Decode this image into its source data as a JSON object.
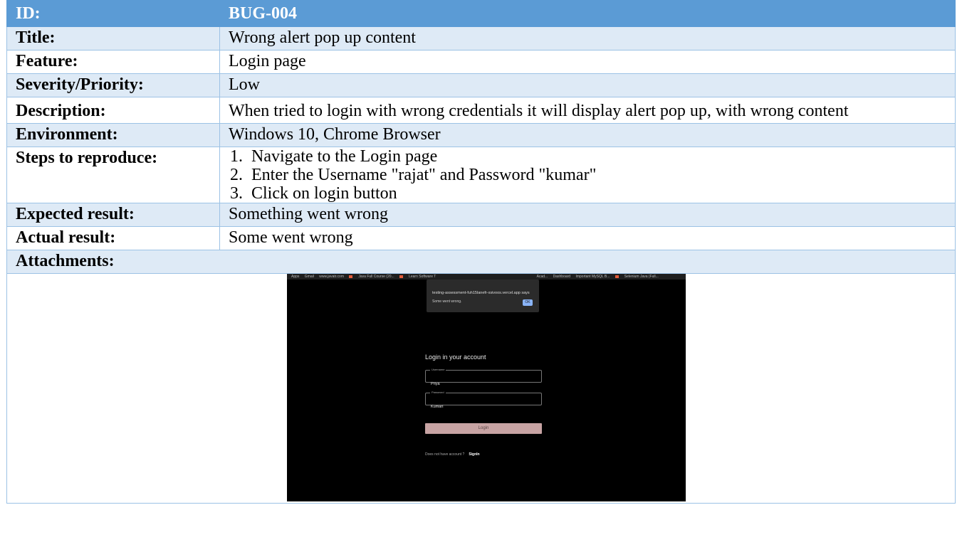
{
  "header": {
    "label": "ID:",
    "value": "BUG-004"
  },
  "rows": {
    "title": {
      "label": "Title:",
      "value": "Wrong alert pop up content"
    },
    "feature": {
      "label": "Feature:",
      "value": "Login page"
    },
    "severity": {
      "label": "Severity/Priority:",
      "value": "Low"
    },
    "description": {
      "label": "Description:",
      "value": "When tried to login with wrong credentials it will display alert pop up, with wrong content"
    },
    "environment": {
      "label": "Environment:",
      "value": "Windows 10, Chrome Browser"
    },
    "steps": {
      "label": "Steps to reproduce:",
      "items": [
        {
          "num": "1.",
          "text": "Navigate to the Login page"
        },
        {
          "num": "2.",
          "text": "Enter the Username \"rajat\" and Password \"kumar\""
        },
        {
          "num": "3.",
          "text": "Click on login button"
        }
      ]
    },
    "expected": {
      "label": "Expected result:",
      "value": "Something went wrong"
    },
    "actual": {
      "label": "Actual result:",
      "value": "Some went wrong"
    },
    "attachments": {
      "label": "Attachments:"
    }
  },
  "screenshot": {
    "bookmarks": [
      "Apps",
      "Gmail",
      "www.javatr.com",
      "Java Full Course (20...",
      "Learn Software T",
      "Acad...",
      "Dashboard",
      "Important MySQL B...",
      "Selenium Java (Full..."
    ],
    "dialog_title": "testing-assessment-fuh15lanefr-xsivoos.vercel.app says",
    "dialog_message": "Some went wrong.",
    "dialog_ok": "OK",
    "login_title": "Login in your account",
    "username_label": "Username",
    "username_value": "Priya",
    "password_label": "Password",
    "password_value": "Kumari",
    "login_button": "Login",
    "no_account": "Does not have account ?",
    "signin": "SignIn"
  }
}
